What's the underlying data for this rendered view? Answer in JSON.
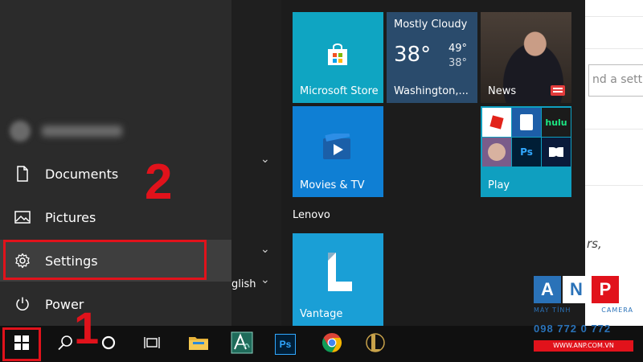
{
  "background_window": {
    "search_placeholder": "nd a settin",
    "text_fragment": "rs,"
  },
  "start_menu": {
    "rail": {
      "items": [
        {
          "label": "Documents",
          "icon": "document-icon"
        },
        {
          "label": "Pictures",
          "icon": "pictures-icon"
        },
        {
          "label": "Settings",
          "icon": "gear-icon"
        },
        {
          "label": "Power",
          "icon": "power-icon"
        }
      ]
    },
    "applist": {
      "partial_label": "glish"
    },
    "tiles": {
      "store": {
        "label": "Microsoft Store"
      },
      "weather": {
        "condition": "Mostly Cloudy",
        "temp": "38°",
        "high": "49°",
        "low": "38°",
        "location": "Washington,..."
      },
      "news": {
        "label": "News"
      },
      "movies": {
        "label": "Movies & TV"
      },
      "play": {
        "label": "Play",
        "apps": [
          "hulu",
          "Ps"
        ]
      },
      "group_header": "Lenovo",
      "vantage": {
        "label": "Vantage"
      }
    }
  },
  "annotations": {
    "step1": "1",
    "step2": "2"
  },
  "taskbar": {
    "items": [
      "windows-start-icon",
      "search-icon",
      "cortana-icon",
      "task-view-icon",
      "file-explorer-icon",
      "app-icon",
      "photoshop-icon",
      "chrome-icon",
      "league-icon"
    ],
    "photoshop_label": "Ps"
  },
  "watermark": {
    "letters": [
      "A",
      "N",
      "P"
    ],
    "tagline_left": "MÁY TÍNH",
    "tagline_right": "CAMERA",
    "phone": "098 772 0 772",
    "url": "WWW.ANP.COM.VN"
  },
  "colors": {
    "accent_red": "#e1121b",
    "tile_blue": "#0f7fd4",
    "watermark_blue": "#2a72b8"
  }
}
